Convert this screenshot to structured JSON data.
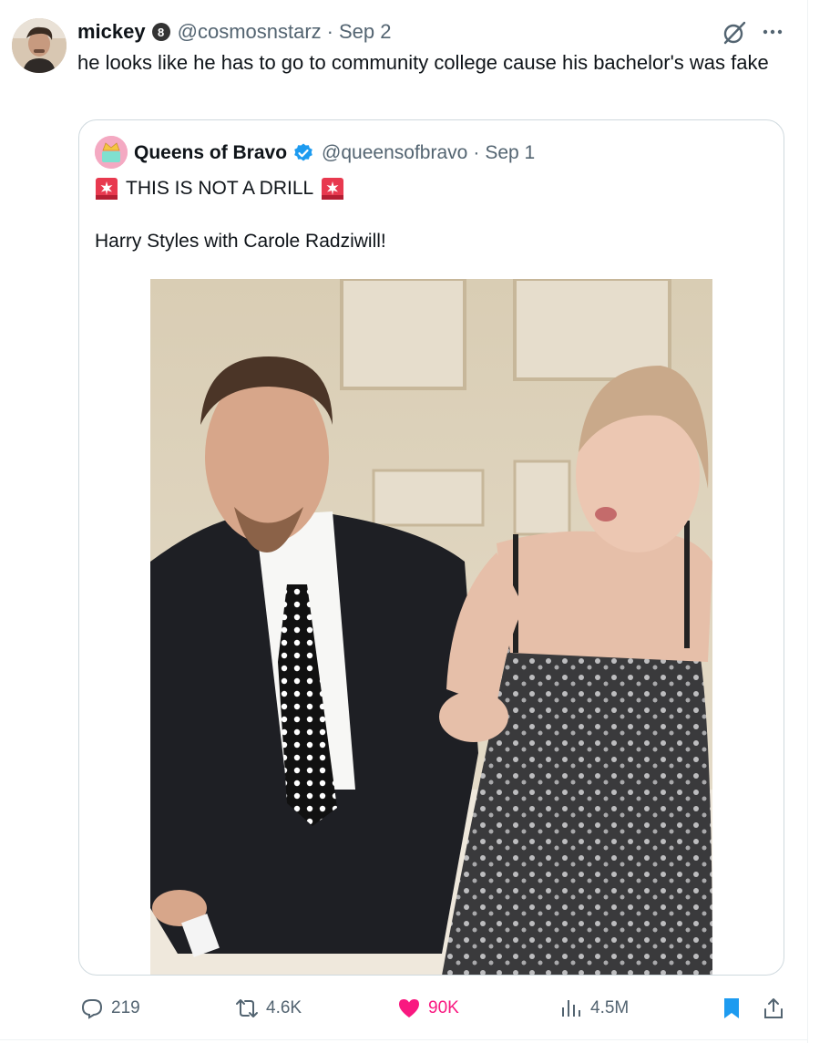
{
  "tweet": {
    "author_name": "mickey",
    "author_badge": "8",
    "handle": "@cosmosnstarz",
    "separator": "·",
    "date": "Sep 2",
    "text": "he looks like he has to go to community college cause his bachelor's was fake"
  },
  "quote": {
    "author_name": "Queens of Bravo",
    "handle": "@queensofbravo",
    "separator": "·",
    "date": "Sep 1",
    "line1": "THIS IS NOT A DRILL",
    "line2": "Harry Styles with Carole Radziwill!",
    "emoji_icon": "police-siren-icon"
  },
  "actions": {
    "replies": "219",
    "reposts": "4.6K",
    "likes": "90K",
    "views": "4.5M"
  },
  "colors": {
    "text": "#0f1419",
    "muted": "#536471",
    "like": "#f91880",
    "bookmark": "#1d9bf0",
    "border": "#cfd9de"
  }
}
